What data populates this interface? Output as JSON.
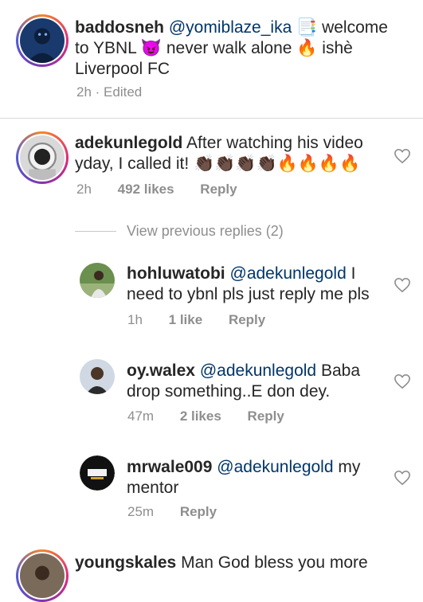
{
  "caption": {
    "username": "baddosneh",
    "mention": "@yomiblaze_ika",
    "text_1": "📑 welcome to YBNL 😈 never walk alone 🔥 ishè Liverpool FC",
    "time": "2h",
    "edited": "· Edited"
  },
  "comments": [
    {
      "username": "adekunlegold",
      "text": "After watching his video yday, I called it! 👏🏿👏🏿👏🏿👏🏿🔥🔥🔥🔥",
      "time": "2h",
      "likes": "492 likes",
      "reply": "Reply"
    }
  ],
  "view_previous": "View previous replies (2)",
  "replies": [
    {
      "username": "hohluwatobi",
      "mention": "@adekunlegold",
      "text": "I need to ybnl pls just reply me pls",
      "time": "1h",
      "likes": "1 like",
      "reply": "Reply"
    },
    {
      "username": "oy.walex",
      "mention": "@adekunlegold",
      "text": "Baba drop something..E don dey.",
      "time": "47m",
      "likes": "2 likes",
      "reply": "Reply"
    },
    {
      "username": "mrwale009",
      "mention": "@adekunlegold",
      "text": "my mentor",
      "time": "25m",
      "reply": "Reply"
    }
  ],
  "last_comment": {
    "username": "youngskales",
    "text": "Man God bless you more"
  }
}
